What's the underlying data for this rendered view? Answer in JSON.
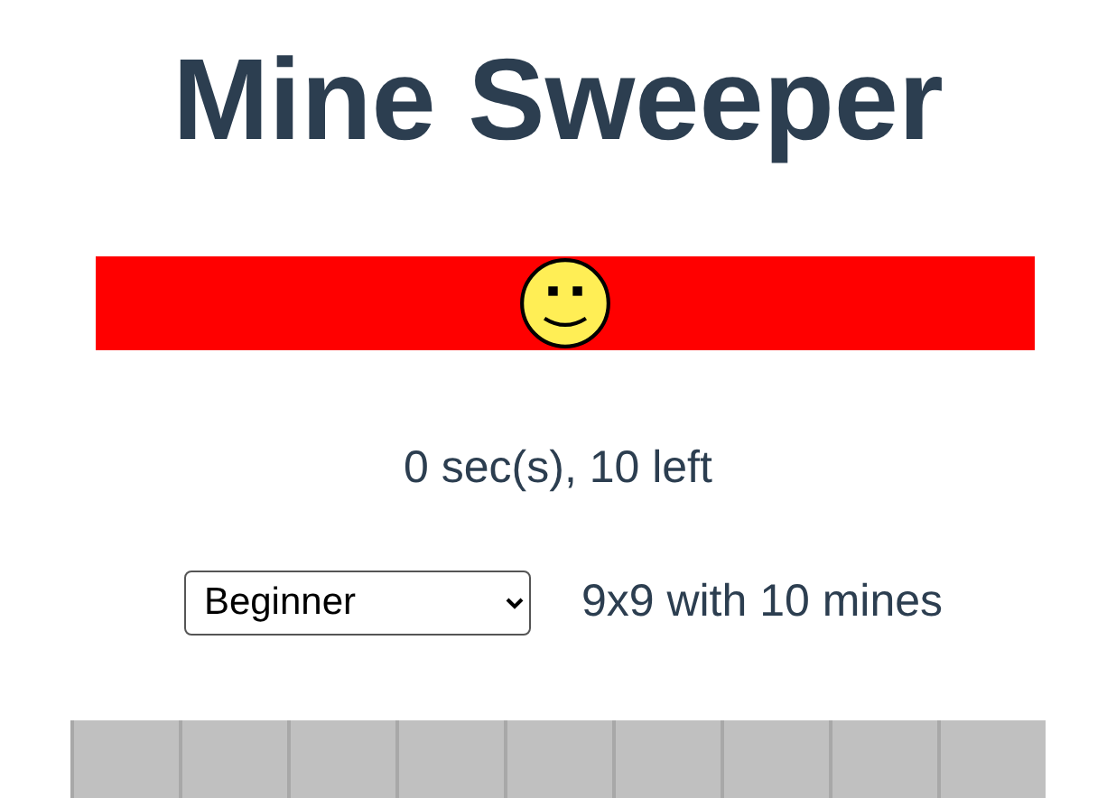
{
  "title": "Mine Sweeper",
  "status": "0 sec(s), 10 left",
  "level_select": {
    "value": "Beginner"
  },
  "level_description": "9x9 with 10 mines",
  "board": {
    "cells": [
      {
        "revealed": false
      },
      {
        "revealed": false
      },
      {
        "revealed": false
      },
      {
        "revealed": false
      },
      {
        "revealed": false
      },
      {
        "revealed": false
      },
      {
        "revealed": false
      },
      {
        "revealed": false
      },
      {
        "revealed": false
      }
    ]
  }
}
